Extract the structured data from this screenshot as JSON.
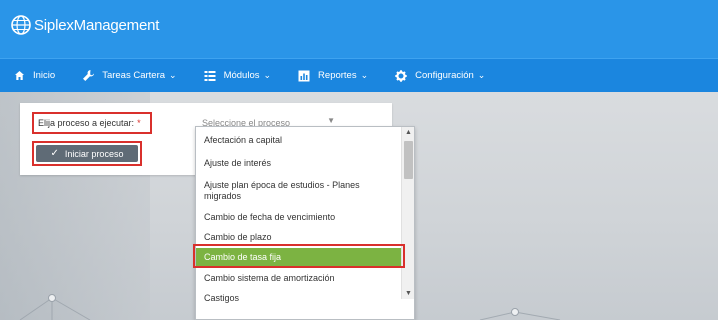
{
  "brand": {
    "name": "SiplexManagement"
  },
  "nav": {
    "items": [
      {
        "label": "Inicio",
        "icon": "home-icon",
        "caret": false
      },
      {
        "label": "Tareas Cartera",
        "icon": "wrench-icon",
        "caret": true
      },
      {
        "label": "Módulos",
        "icon": "grid-icon",
        "caret": true
      },
      {
        "label": "Reportes",
        "icon": "chart-icon",
        "caret": true
      },
      {
        "label": "Configuración",
        "icon": "gear-icon",
        "caret": true
      }
    ]
  },
  "form": {
    "process_label": "Elija proceso a ejecutar:",
    "required_mark": "*",
    "select_placeholder": "Seleccione el proceso",
    "start_button": "Iniciar proceso"
  },
  "dropdown": {
    "options": [
      "Afectación a capital",
      "Ajuste de interés",
      "Ajuste plan época de estudios - Planes migrados",
      "Cambio de fecha de vencimiento",
      "Cambio de plazo",
      "Cambio de tasa fija",
      "Cambio sistema de amortización",
      "Castigos"
    ],
    "selected": "Cambio de tasa fija"
  },
  "colors": {
    "brand_bar": "#2a95e8",
    "nav_bar": "#1b86df",
    "highlight": "#d9302c",
    "selected_option": "#7cb342",
    "button": "#5f6b76"
  }
}
